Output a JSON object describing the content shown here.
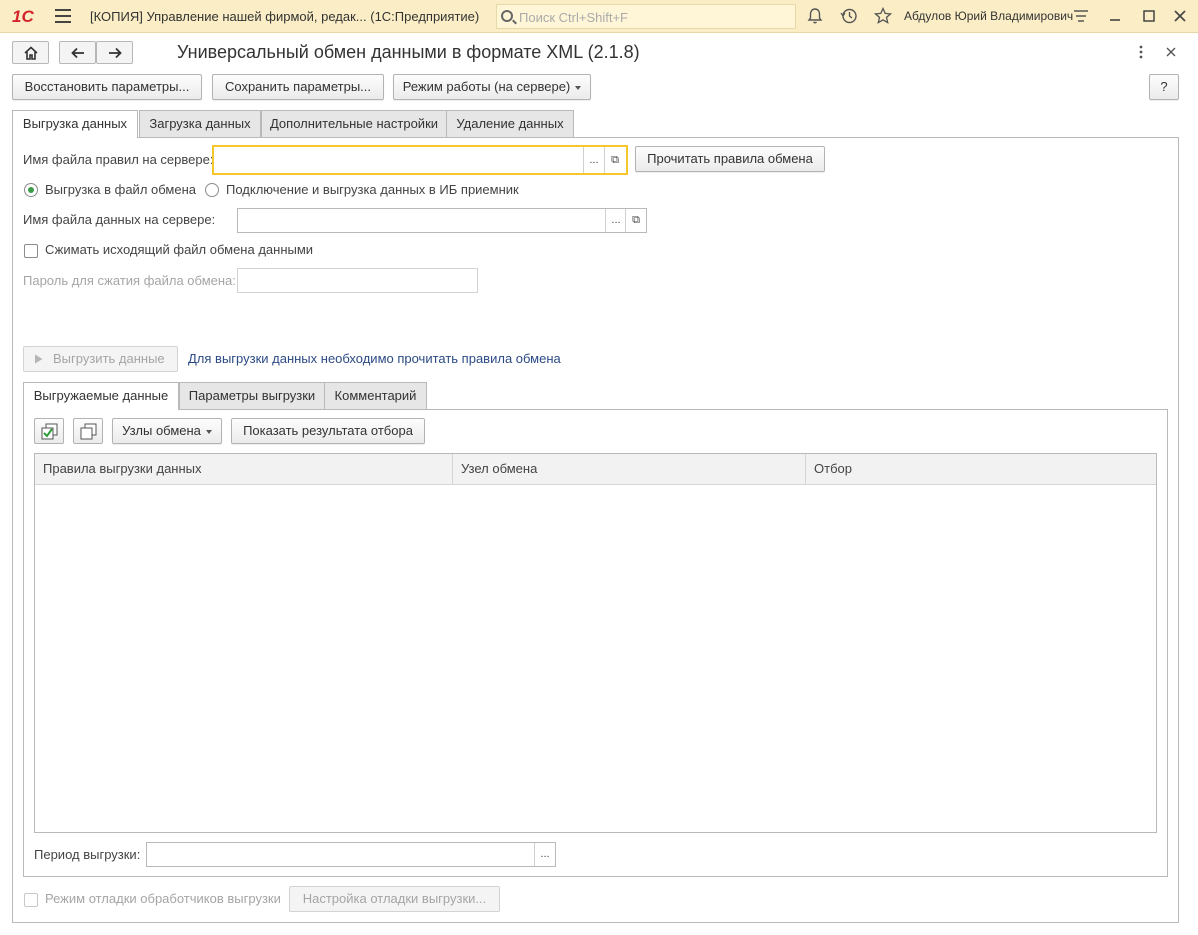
{
  "titlebar": {
    "logo": "1С",
    "app_title": "[КОПИЯ] Управление нашей фирмой, редак...   (1С:Предприятие)",
    "search_placeholder": "Поиск Ctrl+Shift+F",
    "user_name": "Абдулов Юрий Владимирович"
  },
  "form": {
    "title": "Универсальный обмен данными в формате XML (2.1.8)",
    "help_label": "?"
  },
  "toolbar": {
    "restore_label": "Восстановить параметры...",
    "save_label": "Сохранить параметры...",
    "mode_label": "Режим работы (на сервере)"
  },
  "tabs": [
    {
      "label": "Выгрузка данных",
      "active": true
    },
    {
      "label": "Загрузка данных",
      "active": false
    },
    {
      "label": "Дополнительные настройки",
      "active": false
    },
    {
      "label": "Удаление данных",
      "active": false
    }
  ],
  "export": {
    "rules_file_label": "Имя файла правил на сервере:",
    "rules_file_value": "",
    "read_rules_label": "Прочитать правила обмена",
    "radio_file_label": "Выгрузка в файл обмена",
    "radio_connect_label": "Подключение и выгрузка данных в ИБ приемник",
    "data_file_label": "Имя файла данных на сервере:",
    "data_file_value": "",
    "compress_label": "Сжимать исходящий файл обмена данными",
    "password_label": "Пароль для сжатия файла обмена:",
    "export_button_label": "Выгрузить данные",
    "hint_link": "Для выгрузки данных необходимо прочитать правила обмена",
    "inner_tabs": [
      {
        "label": "Выгружаемые данные",
        "active": true
      },
      {
        "label": "Параметры выгрузки",
        "active": false
      },
      {
        "label": "Комментарий",
        "active": false
      }
    ],
    "nodes_button_label": "Узлы обмена",
    "show_filter_label": "Показать результата отбора",
    "table_headers": [
      "Правила выгрузки данных",
      "Узел обмена",
      "Отбор"
    ],
    "period_label": "Период выгрузки:",
    "period_value": "",
    "debug_label": "Режим отладки обработчиков выгрузки",
    "debug_settings_label": "Настройка отладки выгрузки..."
  },
  "colors": {
    "titlebar_bg": "#fbeec6",
    "focus_border": "#f5c92c",
    "link": "#2b4a85",
    "radio_on": "#3c9c4a"
  }
}
